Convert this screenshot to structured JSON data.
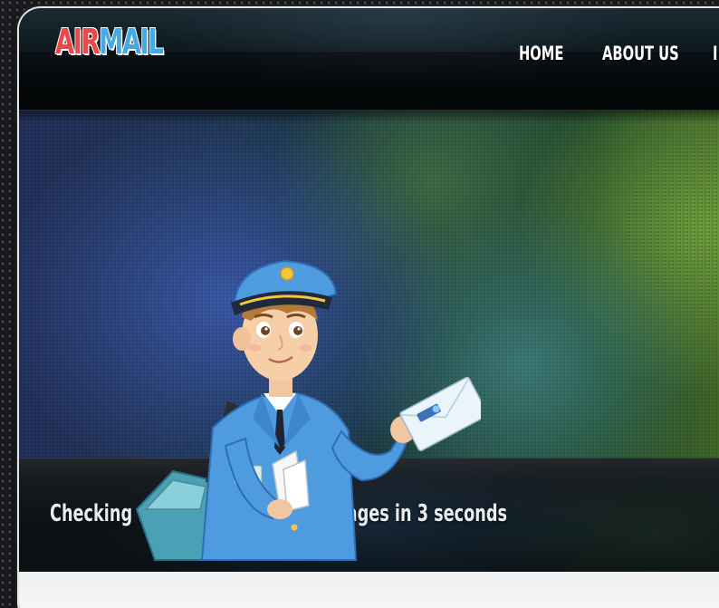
{
  "header": {
    "logo": {
      "part1": "AIR",
      "part2": "MAIL"
    },
    "nav": [
      {
        "label": "HOME"
      },
      {
        "label": "ABOUT US"
      }
    ]
  },
  "status": {
    "message": "Checking for new incoming messages in 3 seconds"
  },
  "colors": {
    "logo_red": "#e84a4a",
    "logo_blue": "#45a9e4",
    "uniform_blue": "#4f9be0"
  },
  "icons": [
    "mailman-illustration",
    "envelope-icon",
    "key-icon"
  ]
}
